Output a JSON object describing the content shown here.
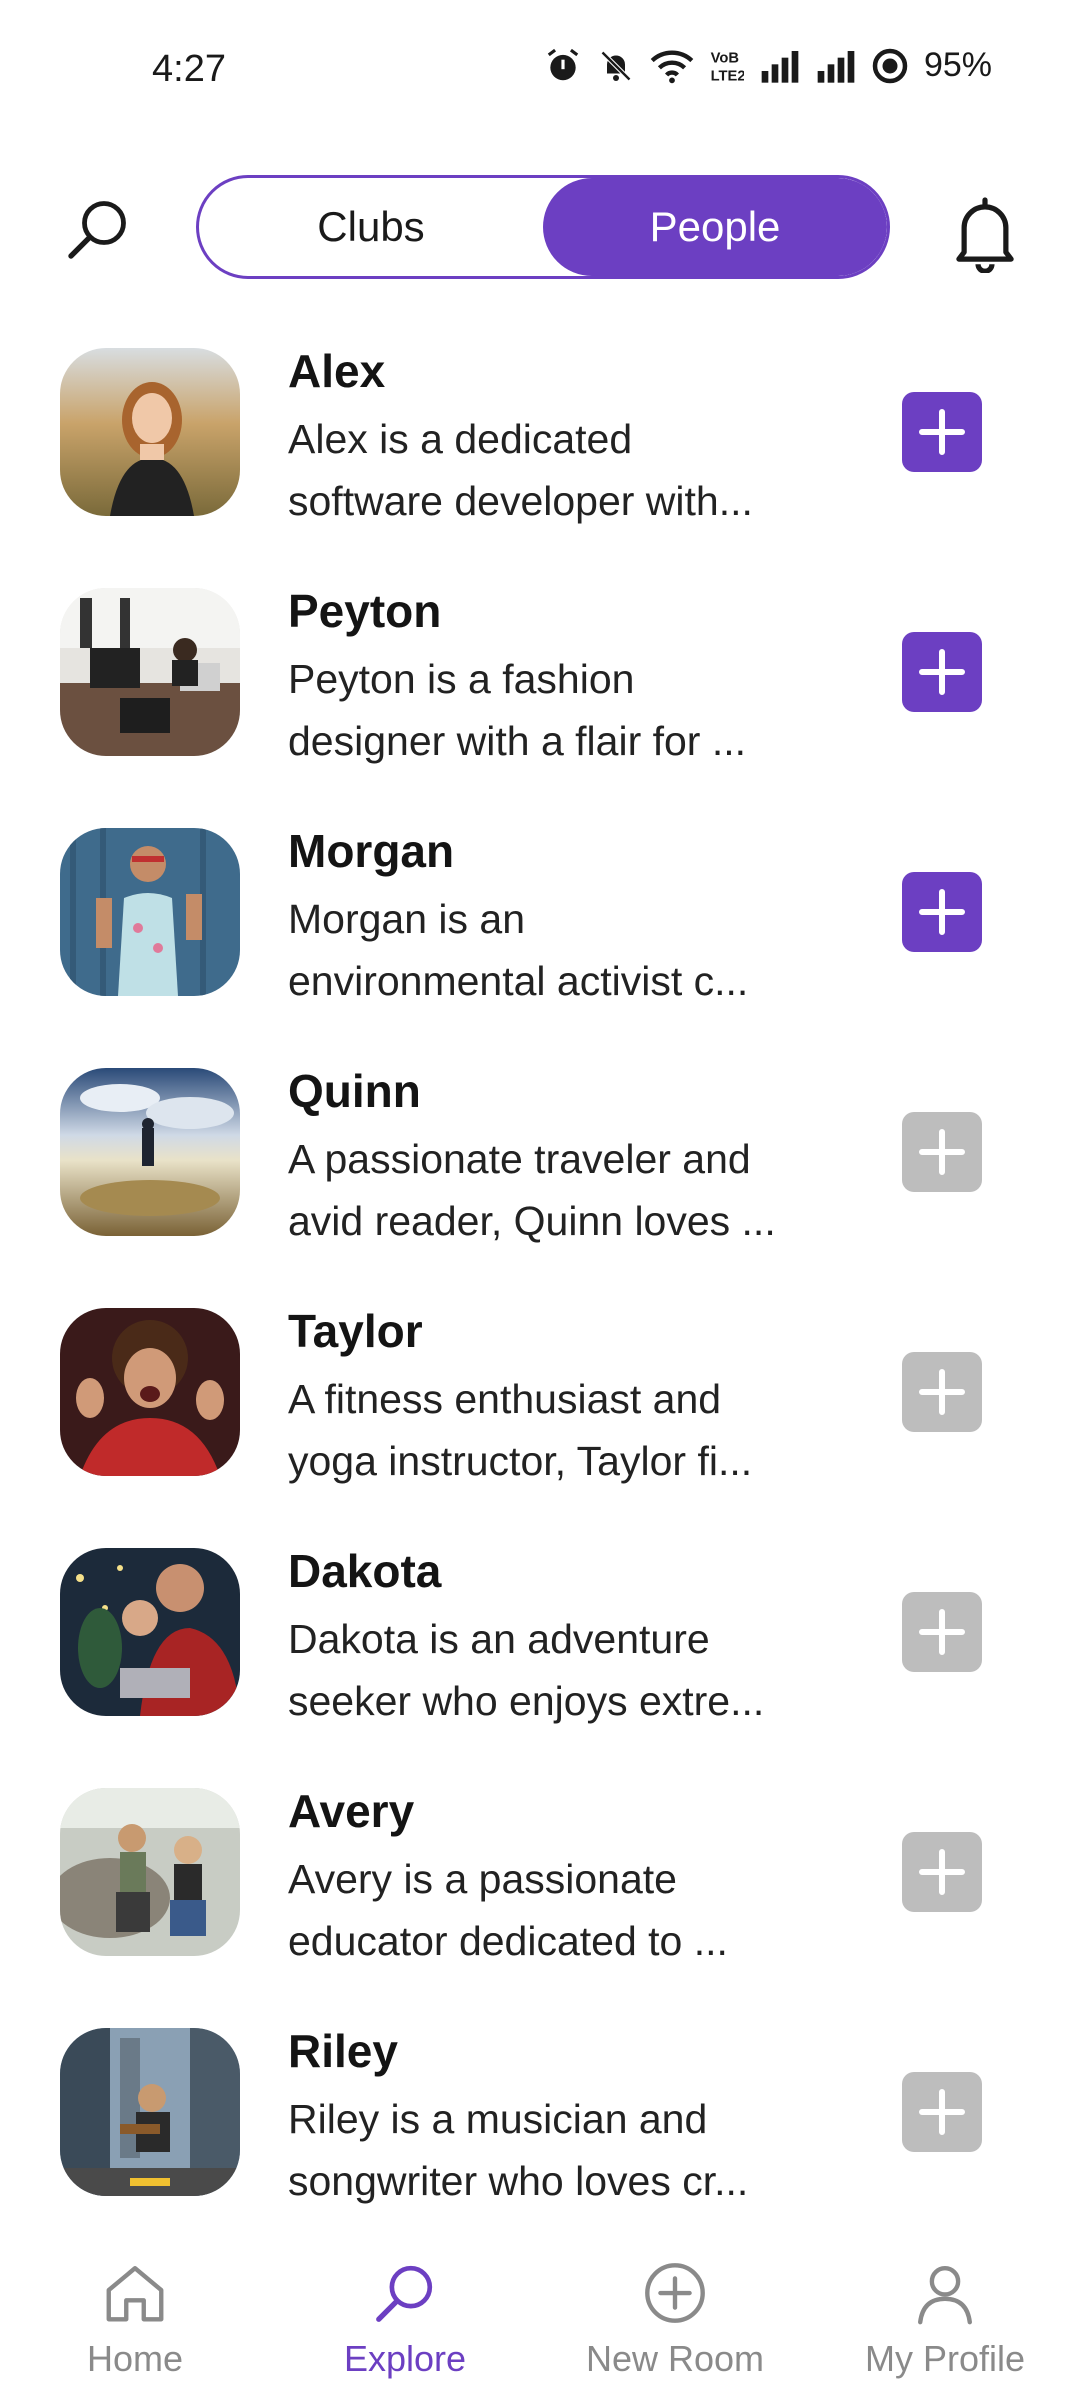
{
  "status_bar": {
    "time": "4:27",
    "battery": "95%",
    "icons": [
      "alarm-icon",
      "mute-icon",
      "wifi-icon",
      "volte-icon",
      "signal-icon",
      "signal-icon",
      "battery-saver-icon"
    ]
  },
  "header": {
    "tabs": [
      {
        "label": "Clubs",
        "active": false
      },
      {
        "label": "People",
        "active": true
      }
    ]
  },
  "colors": {
    "accent": "#6c3fc2",
    "disabled": "#bdbdbd"
  },
  "people": [
    {
      "name": "Alex",
      "line1": "Alex is a dedicated",
      "line2": "software developer with...",
      "add_enabled": true
    },
    {
      "name": "Peyton",
      "line1": "Peyton is a fashion",
      "line2": "designer with a flair for ...",
      "add_enabled": true
    },
    {
      "name": "Morgan",
      "line1": "Morgan is an",
      "line2": "environmental activist c...",
      "add_enabled": true
    },
    {
      "name": "Quinn",
      "line1": "A passionate traveler and",
      "line2": "avid reader, Quinn loves ...",
      "add_enabled": false
    },
    {
      "name": "Taylor",
      "line1": "A fitness enthusiast and",
      "line2": "yoga instructor, Taylor fi...",
      "add_enabled": false
    },
    {
      "name": "Dakota",
      "line1": "Dakota is an adventure",
      "line2": "seeker who enjoys extre...",
      "add_enabled": false
    },
    {
      "name": "Avery",
      "line1": "Avery is a passionate",
      "line2": "educator dedicated to ...",
      "add_enabled": false
    },
    {
      "name": "Riley",
      "line1": "Riley is a musician and",
      "line2": "songwriter who loves cr...",
      "add_enabled": false
    }
  ],
  "bottom_nav": [
    {
      "label": "Home",
      "icon": "home-icon",
      "active": false
    },
    {
      "label": "Explore",
      "icon": "search-icon",
      "active": true
    },
    {
      "label": "New Room",
      "icon": "add-circle-icon",
      "active": false
    },
    {
      "label": "My Profile",
      "icon": "person-icon",
      "active": false
    }
  ]
}
